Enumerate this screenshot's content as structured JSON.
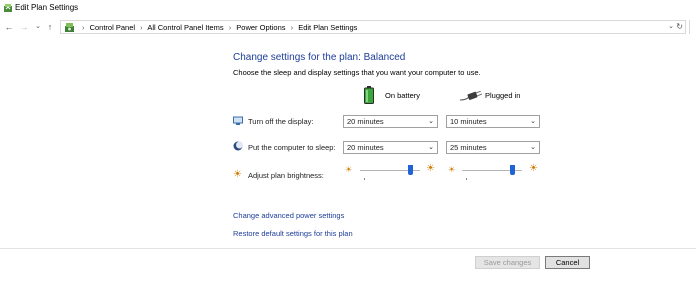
{
  "window": {
    "title": "Edit Plan Settings"
  },
  "nav": {
    "back": "←",
    "forward": "→",
    "recent": "⌄",
    "up": "↑"
  },
  "breadcrumb": {
    "items": [
      "Control Panel",
      "All Control Panel Items",
      "Power Options",
      "Edit Plan Settings"
    ],
    "separator": "›",
    "dropdown": "⌄",
    "refresh": "↻"
  },
  "main": {
    "heading": "Change settings for the plan: Balanced",
    "subheading": "Choose the sleep and display settings that you want your computer to use.",
    "columns": {
      "battery": "On battery",
      "plugged": "Plugged in"
    },
    "rows": [
      {
        "label": "Turn off the display:",
        "battery": "20 minutes",
        "plugged": "10 minutes"
      },
      {
        "label": "Put the computer to sleep:",
        "battery": "20 minutes",
        "plugged": "25 minutes"
      }
    ],
    "brightness": {
      "label": "Adjust plan brightness:",
      "battery_level": 0.88,
      "plugged_level": 0.88
    }
  },
  "links": {
    "advanced": "Change advanced power settings",
    "restore": "Restore default settings for this plan"
  },
  "footer": {
    "save": "Save changes",
    "cancel": "Cancel"
  },
  "icons": {
    "titlebar": "power-plan-icon",
    "battery": "battery-icon",
    "plug": "power-plug-icon",
    "display": "display-icon",
    "sleep": "moon-icon",
    "brightness": "sun-icon"
  },
  "colors": {
    "heading": "#1e3d9a",
    "link": "#1e3d9a",
    "slider": "#1e64d6",
    "battery": "#3aa53a"
  }
}
